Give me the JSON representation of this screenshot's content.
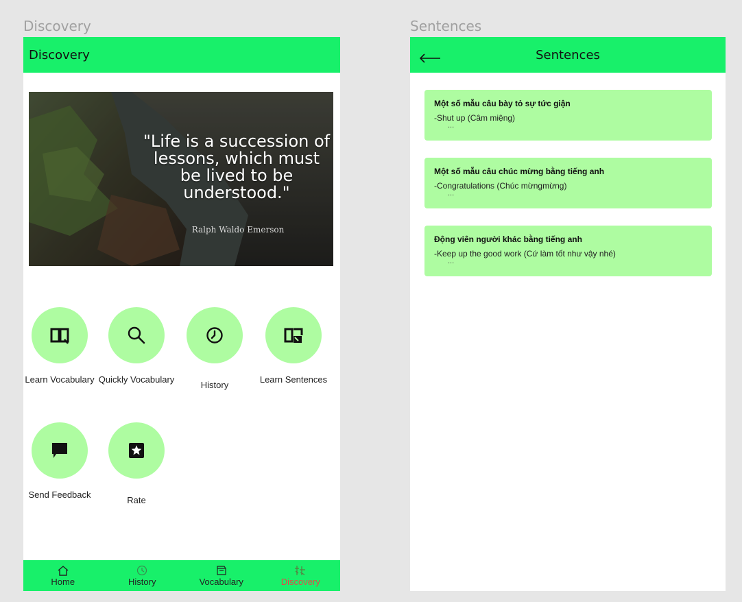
{
  "frames": {
    "left_title": "Discovery",
    "right_title": "Sentences"
  },
  "discovery": {
    "appbar_title": "Discovery",
    "hero": {
      "quote": "\"Life is a succession of lessons, which must be lived to be understood.\"",
      "author": "Ralph Waldo Emerson"
    },
    "features": [
      {
        "label": "Learn Vocabulary",
        "icon": "open-book-icon"
      },
      {
        "label": "Quickly Vocabulary",
        "icon": "search-icon"
      },
      {
        "label": "History",
        "icon": "clock-icon"
      },
      {
        "label": "Learn Sentences",
        "icon": "sentences-book-icon"
      },
      {
        "label": "Send Feedback",
        "icon": "chat-bubble-icon"
      },
      {
        "label": "Rate",
        "icon": "star-box-icon"
      }
    ],
    "bottom_nav": [
      {
        "label": "Home",
        "icon": "home-icon",
        "active": false
      },
      {
        "label": "History",
        "icon": "clock-icon",
        "active": false
      },
      {
        "label": "Vocabulary",
        "icon": "book-icon",
        "active": false
      },
      {
        "label": "Discovery",
        "icon": "discovery-icon",
        "active": true
      }
    ]
  },
  "sentences": {
    "appbar_title": "Sentences",
    "back_icon": "back-arrow-icon",
    "cards": [
      {
        "title": "Một số mẫu câu bày tỏ sự tức giận",
        "example": "-Shut up (Câm miệng)",
        "more": "..."
      },
      {
        "title": "Một số mẫu câu chúc mừng bằng tiếng anh",
        "example": "-Congratulations (Chúc mừngmừng)",
        "more": "..."
      },
      {
        "title": "Động viên người khác bằng tiếng anh",
        "example": "-Keep up the good work (Cứ làm tốt như vậy nhé)",
        "more": "..."
      }
    ]
  },
  "colors": {
    "appbar": "#18f06a",
    "accent_light": "#aefca1",
    "nav_active": "#e04a4a",
    "canvas": "#e6e6e6"
  }
}
